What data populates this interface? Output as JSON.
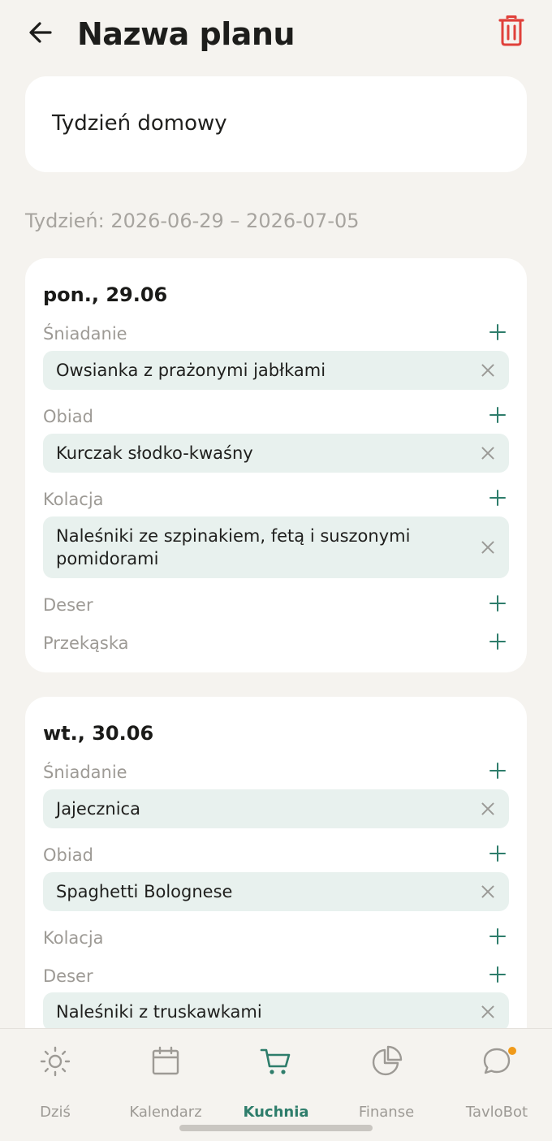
{
  "header": {
    "title": "Nazwa planu"
  },
  "plan": {
    "name": "Tydzień domowy",
    "week_label": "Tydzień: 2026-06-29 – 2026-07-05"
  },
  "days": [
    {
      "title": "pon., 29.06",
      "meals": {
        "breakfast": {
          "label": "Śniadanie",
          "dish": "Owsianka z prażonymi jabłkami"
        },
        "lunch": {
          "label": "Obiad",
          "dish": "Kurczak słodko-kwaśny"
        },
        "dinner": {
          "label": "Kolacja",
          "dish": "Naleśniki ze szpinakiem, fetą i suszonymi pomidorami"
        },
        "dessert": {
          "label": "Deser"
        },
        "snack": {
          "label": "Przekąska"
        }
      }
    },
    {
      "title": "wt., 30.06",
      "meals": {
        "breakfast": {
          "label": "Śniadanie",
          "dish": "Jajecznica"
        },
        "lunch": {
          "label": "Obiad",
          "dish": "Spaghetti Bolognese"
        },
        "dinner": {
          "label": "Kolacja"
        },
        "dessert": {
          "label": "Deser",
          "dish": "Naleśniki z truskawkami"
        }
      }
    }
  ],
  "bottom_nav": {
    "items": [
      {
        "label": "Dziś",
        "icon": "sun-icon"
      },
      {
        "label": "Kalendarz",
        "icon": "calendar-icon"
      },
      {
        "label": "Kuchnia",
        "icon": "cart-icon",
        "active": true
      },
      {
        "label": "Finanse",
        "icon": "pie-chart-icon"
      },
      {
        "label": "TavloBot",
        "icon": "chat-bubble-icon",
        "notification": true
      }
    ]
  },
  "colors": {
    "accent": "#2e7d6b",
    "danger": "#e0403a",
    "background": "#f5f3ef",
    "dish_background": "#e8f1ee",
    "notification": "#f09a1a"
  }
}
